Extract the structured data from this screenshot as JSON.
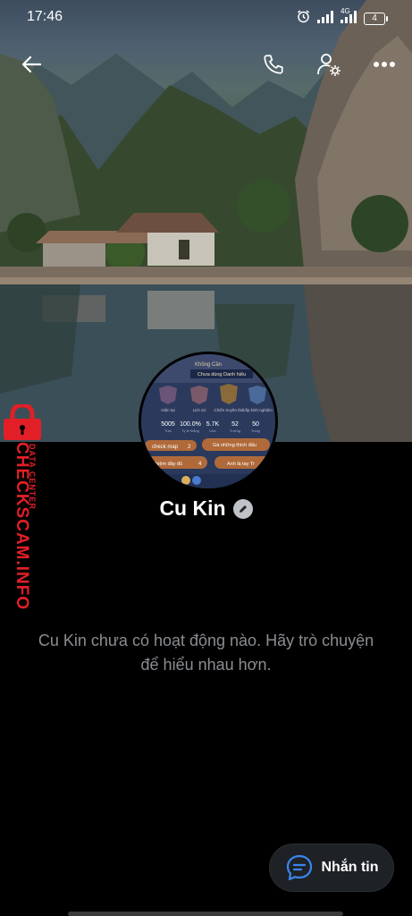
{
  "status_bar": {
    "time": "17:46",
    "network": "4G",
    "battery": "4",
    "icons": [
      "alarm-icon",
      "signal-icon",
      "signal-4g-icon",
      "battery-icon"
    ]
  },
  "top_bar": {
    "icons": [
      "back-arrow-icon",
      "phone-icon",
      "profile-settings-icon",
      "more-icon"
    ]
  },
  "profile": {
    "name": "Cu Kin",
    "empty_activity_message": "Cu Kin chưa có hoạt động nào. Hãy trò chuyện để hiểu nhau hơn."
  },
  "avatar_game_card": {
    "top_lines": [
      "Không Cần",
      "Chưa dùng Danh hiệu"
    ],
    "tabs": [
      "Hiện tại",
      "Lịch sử",
      "Chiến truyền thủ",
      "Cấp kinh nghiệm"
    ],
    "stats": [
      "5005",
      "100.0%",
      "5.7K",
      "52",
      "50"
    ],
    "stat_labels": [
      "Trận",
      "Tỷ lệ thắng",
      "Like",
      "Tướng",
      "Trang"
    ],
    "chips": [
      "check map",
      "2",
      "Gà những thích đấu",
      "nghiệm đầy đủ",
      "4",
      "Anh là tay Tr"
    ]
  },
  "watermark": {
    "main": "CHECKSCAM.INFO",
    "sub": "DATA CENTER"
  },
  "fab": {
    "label": "Nhắn tin"
  },
  "colors": {
    "background": "#000000",
    "muted_text": "#8a8d91",
    "watermark_red": "#e21f26",
    "fab_bg": "#1e2226",
    "fab_icon": "#3a86f0"
  }
}
